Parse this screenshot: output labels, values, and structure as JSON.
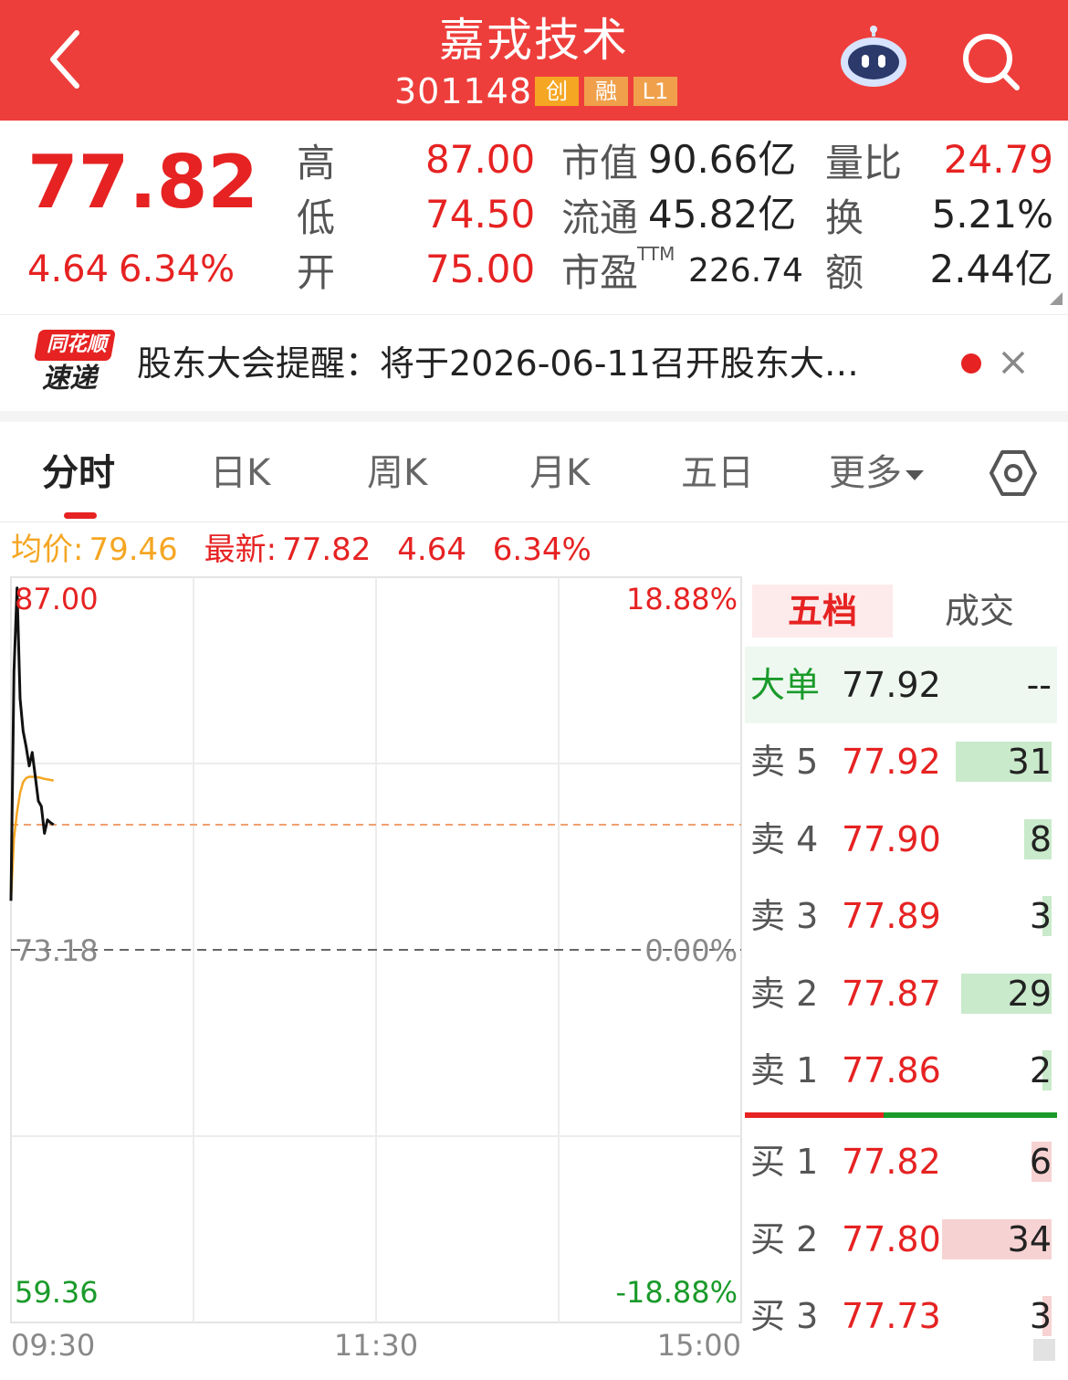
{
  "header": {
    "title": "嘉戎技术",
    "code": "301148",
    "tags": [
      {
        "label": "创",
        "color": "#f5a623"
      },
      {
        "label": "融",
        "color": "#f0a04b"
      },
      {
        "label": "L1",
        "color": "#f0a04b"
      }
    ],
    "bg_color": "#ee3e3b"
  },
  "quote": {
    "price": "77.82",
    "change": "4.64",
    "change_pct": "6.34%",
    "high_label": "高",
    "high": "87.00",
    "low_label": "低",
    "low": "74.50",
    "open_label": "开",
    "open": "75.00",
    "mcap_label": "市值",
    "mcap": "90.66亿",
    "float_label": "流通",
    "float": "45.82亿",
    "pe_label": "市盈",
    "pe_sup": "TTM",
    "pe": "226.74",
    "vr_label": "量比",
    "vr": "24.79",
    "turnover_label": "换",
    "turnover": "5.21%",
    "amount_label": "额",
    "amount": "2.44亿",
    "up_color": "#e62222"
  },
  "news": {
    "logo_top": "同花顺",
    "logo_bottom": "速递",
    "text": "股东大会提醒：将于2026-06-11召开股东大…"
  },
  "tabs": [
    "分时",
    "日K",
    "周K",
    "月K",
    "五日",
    "更多"
  ],
  "active_tab": "分时",
  "legend": {
    "avg_label": "均价:",
    "avg": "79.46",
    "latest_label": "最新:",
    "latest": "77.82",
    "change": "4.64",
    "change_pct": "6.34%"
  },
  "chart_data": {
    "type": "line",
    "title": "",
    "xlabel": "",
    "ylabel": "",
    "x_ticks": [
      "09:30",
      "11:30",
      "15:00"
    ],
    "y_left_ticks": [
      "87.00",
      "73.18",
      "59.36"
    ],
    "y_right_ticks": [
      "18.88%",
      "0.00%",
      "-18.88%"
    ],
    "ylim": [
      59.36,
      87.0
    ],
    "prev_close": 73.18,
    "series": [
      {
        "color": "#111111",
        "x": [
          "09:30",
          "09:31",
          "09:32",
          "09:33",
          "09:34",
          "09:35",
          "09:36",
          "09:37",
          "09:38",
          "09:39",
          "09:40",
          "09:41",
          "09:42",
          "09:43",
          "09:44"
        ],
        "values": [
          75.0,
          83.5,
          86.6,
          82.5,
          81.3,
          80.7,
          80.0,
          80.5,
          79.6,
          78.7,
          78.5,
          77.5,
          78.0,
          77.9,
          77.82
        ]
      },
      {
        "color": "#f5a623",
        "x": [
          "09:30",
          "09:31",
          "09:32",
          "09:33",
          "09:34",
          "09:35",
          "09:36",
          "09:37",
          "09:38",
          "09:39",
          "09:40",
          "09:41",
          "09:42",
          "09:43",
          "09:44"
        ],
        "values": [
          75.0,
          77.3,
          78.3,
          79.0,
          79.4,
          79.55,
          79.6,
          79.6,
          79.6,
          79.58,
          79.55,
          79.52,
          79.5,
          79.48,
          79.46
        ]
      }
    ]
  },
  "orderbook": {
    "tabs": [
      "五档",
      "成交"
    ],
    "big_label": "大单",
    "big_price": "77.92",
    "big_vol": "--",
    "asks": [
      {
        "label": "卖 5",
        "price": "77.92",
        "vol": "31",
        "bar": 0.7
      },
      {
        "label": "卖 4",
        "price": "77.90",
        "vol": "8",
        "bar": 0.2
      },
      {
        "label": "卖 3",
        "price": "77.89",
        "vol": "3",
        "bar": 0.06
      },
      {
        "label": "卖 2",
        "price": "77.87",
        "vol": "29",
        "bar": 0.66
      },
      {
        "label": "卖 1",
        "price": "77.86",
        "vol": "2",
        "bar": 0.05
      }
    ],
    "bids": [
      {
        "label": "买 1",
        "price": "77.82",
        "vol": "6",
        "bar": 0.15
      },
      {
        "label": "买 2",
        "price": "77.80",
        "vol": "34",
        "bar": 0.8
      },
      {
        "label": "买 3",
        "price": "77.73",
        "vol": "3",
        "bar": 0.06
      }
    ],
    "ask_bar_color": "#c9eacb",
    "bid_bar_color": "#f7d2d2"
  }
}
